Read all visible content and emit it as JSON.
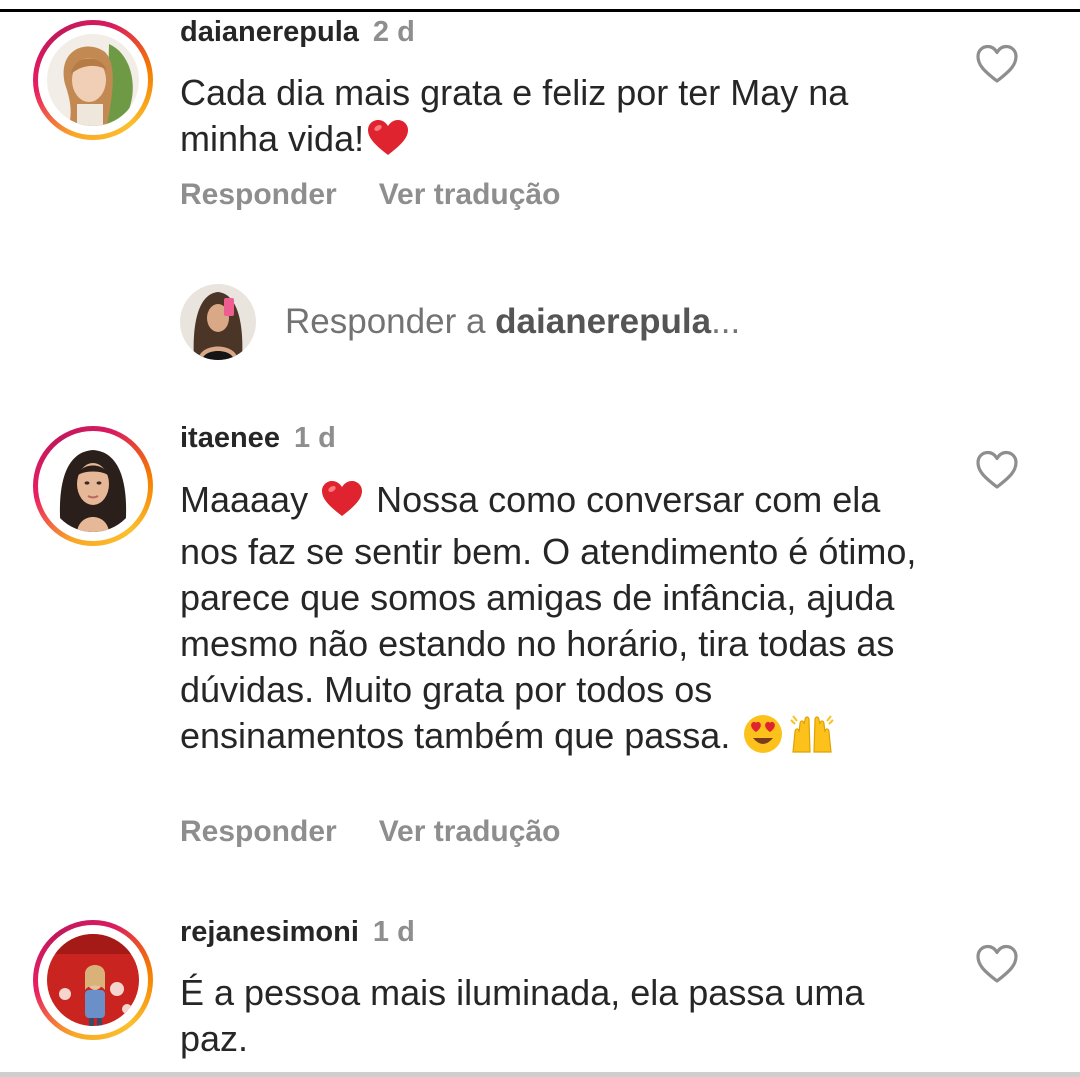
{
  "comments": [
    {
      "username": "daianerepula",
      "time": "2 d",
      "text_before": "Cada dia mais grata e feliz por ter  May na minha vida!",
      "text_emoji": "red-heart",
      "reply_label": "Responder",
      "translate_label": "Ver tradução"
    },
    {
      "username": "itaenee",
      "time": "1 d",
      "text_start": "Maaaay",
      "text_emoji_1": "red-heart",
      "text_body": "Nossa como conversar com ela nos faz se sentir bem. O atendimento é ótimo, parece que somos amigas de infância, ajuda mesmo não estando no horário, tira todas as dúvidas.  Muito grata por todos os ensinamentos também que passa.",
      "text_emoji_2": "heart-eyes",
      "text_emoji_3": "raising-hands",
      "reply_label": "Responder",
      "translate_label": "Ver tradução"
    },
    {
      "username": "rejanesimoni",
      "time": "1 d",
      "text": "É a pessoa mais iluminada, ela passa uma paz."
    }
  ],
  "reply_field": {
    "prefix": "Responder a",
    "target": "daianerepula",
    "suffix": "..."
  },
  "colors": {
    "text": "#262626",
    "muted": "#8e8e8e",
    "heart": "#e0242f"
  }
}
